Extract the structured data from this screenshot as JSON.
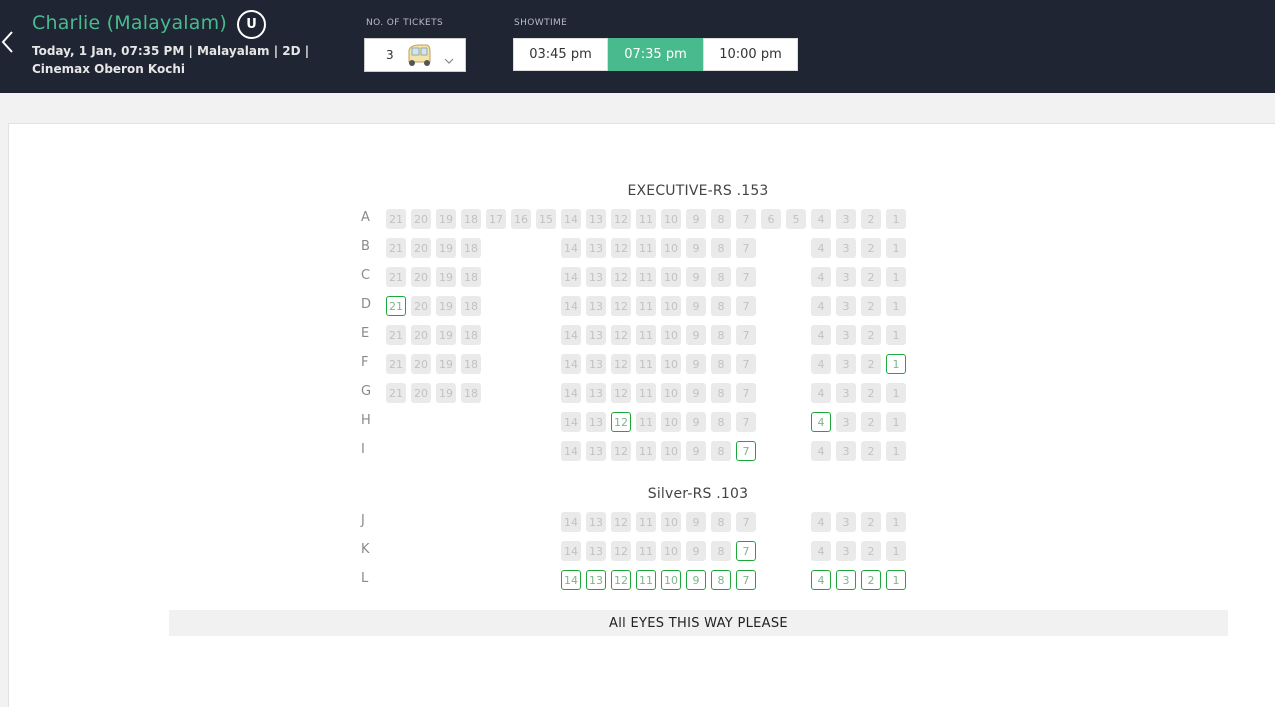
{
  "header": {
    "movie_title": "Charlie (Malayalam)",
    "certificate": "U",
    "show_line1": "Today, 1 Jan, 07:35 PM | Malayalam | 2D |",
    "show_line2": "Cinemax Oberon Kochi"
  },
  "tickets": {
    "label": "NO. OF TICKETS",
    "value": "3"
  },
  "showtime": {
    "label": "SHOWTIME",
    "options": [
      {
        "label": "03:45 pm",
        "selected": false
      },
      {
        "label": "07:35 pm",
        "selected": true
      },
      {
        "label": "10:00 pm",
        "selected": false
      }
    ]
  },
  "colors": {
    "brand_green": "#49ba8e",
    "available_border": "#1ea83c",
    "header_bg": "#1f2533",
    "sold_bg": "#eaeaea"
  },
  "sections": [
    {
      "title": "EXECUTIVE-RS .153"
    },
    {
      "title": "Silver-RS .103"
    }
  ],
  "seat_rows": [
    {
      "row": "A",
      "section": 0,
      "seats": [
        {
          "n": "21",
          "a": false
        },
        {
          "n": "20",
          "a": false
        },
        {
          "n": "19",
          "a": false
        },
        {
          "n": "18",
          "a": false
        },
        {
          "n": "17",
          "a": false
        },
        {
          "n": "16",
          "a": false
        },
        {
          "n": "15",
          "a": false
        },
        {
          "n": "14",
          "a": false
        },
        {
          "n": "13",
          "a": false
        },
        {
          "n": "12",
          "a": false
        },
        {
          "n": "11",
          "a": false
        },
        {
          "n": "10",
          "a": false
        },
        {
          "n": "9",
          "a": false
        },
        {
          "n": "8",
          "a": false
        },
        {
          "n": "7",
          "a": false
        },
        {
          "n": "6",
          "a": false
        },
        {
          "n": "5",
          "a": false
        },
        {
          "n": "4",
          "a": false
        },
        {
          "n": "3",
          "a": false
        },
        {
          "n": "2",
          "a": false
        },
        {
          "n": "1",
          "a": false
        }
      ]
    },
    {
      "row": "B",
      "section": 0,
      "seats": [
        {
          "n": "21",
          "a": false
        },
        {
          "n": "20",
          "a": false
        },
        {
          "n": "19",
          "a": false
        },
        {
          "n": "18",
          "a": false
        },
        null,
        null,
        null,
        {
          "n": "14",
          "a": false
        },
        {
          "n": "13",
          "a": false
        },
        {
          "n": "12",
          "a": false
        },
        {
          "n": "11",
          "a": false
        },
        {
          "n": "10",
          "a": false
        },
        {
          "n": "9",
          "a": false
        },
        {
          "n": "8",
          "a": false
        },
        {
          "n": "7",
          "a": false
        },
        null,
        null,
        {
          "n": "4",
          "a": false
        },
        {
          "n": "3",
          "a": false
        },
        {
          "n": "2",
          "a": false
        },
        {
          "n": "1",
          "a": false
        }
      ]
    },
    {
      "row": "C",
      "section": 0,
      "seats": [
        {
          "n": "21",
          "a": false
        },
        {
          "n": "20",
          "a": false
        },
        {
          "n": "19",
          "a": false
        },
        {
          "n": "18",
          "a": false
        },
        null,
        null,
        null,
        {
          "n": "14",
          "a": false
        },
        {
          "n": "13",
          "a": false
        },
        {
          "n": "12",
          "a": false
        },
        {
          "n": "11",
          "a": false
        },
        {
          "n": "10",
          "a": false
        },
        {
          "n": "9",
          "a": false
        },
        {
          "n": "8",
          "a": false
        },
        {
          "n": "7",
          "a": false
        },
        null,
        null,
        {
          "n": "4",
          "a": false
        },
        {
          "n": "3",
          "a": false
        },
        {
          "n": "2",
          "a": false
        },
        {
          "n": "1",
          "a": false
        }
      ]
    },
    {
      "row": "D",
      "section": 0,
      "seats": [
        {
          "n": "21",
          "a": true
        },
        {
          "n": "20",
          "a": false
        },
        {
          "n": "19",
          "a": false
        },
        {
          "n": "18",
          "a": false
        },
        null,
        null,
        null,
        {
          "n": "14",
          "a": false
        },
        {
          "n": "13",
          "a": false
        },
        {
          "n": "12",
          "a": false
        },
        {
          "n": "11",
          "a": false
        },
        {
          "n": "10",
          "a": false
        },
        {
          "n": "9",
          "a": false
        },
        {
          "n": "8",
          "a": false
        },
        {
          "n": "7",
          "a": false
        },
        null,
        null,
        {
          "n": "4",
          "a": false
        },
        {
          "n": "3",
          "a": false
        },
        {
          "n": "2",
          "a": false
        },
        {
          "n": "1",
          "a": false
        }
      ]
    },
    {
      "row": "E",
      "section": 0,
      "seats": [
        {
          "n": "21",
          "a": false
        },
        {
          "n": "20",
          "a": false
        },
        {
          "n": "19",
          "a": false
        },
        {
          "n": "18",
          "a": false
        },
        null,
        null,
        null,
        {
          "n": "14",
          "a": false
        },
        {
          "n": "13",
          "a": false
        },
        {
          "n": "12",
          "a": false
        },
        {
          "n": "11",
          "a": false
        },
        {
          "n": "10",
          "a": false
        },
        {
          "n": "9",
          "a": false
        },
        {
          "n": "8",
          "a": false
        },
        {
          "n": "7",
          "a": false
        },
        null,
        null,
        {
          "n": "4",
          "a": false
        },
        {
          "n": "3",
          "a": false
        },
        {
          "n": "2",
          "a": false
        },
        {
          "n": "1",
          "a": false
        }
      ]
    },
    {
      "row": "F",
      "section": 0,
      "seats": [
        {
          "n": "21",
          "a": false
        },
        {
          "n": "20",
          "a": false
        },
        {
          "n": "19",
          "a": false
        },
        {
          "n": "18",
          "a": false
        },
        null,
        null,
        null,
        {
          "n": "14",
          "a": false
        },
        {
          "n": "13",
          "a": false
        },
        {
          "n": "12",
          "a": false
        },
        {
          "n": "11",
          "a": false
        },
        {
          "n": "10",
          "a": false
        },
        {
          "n": "9",
          "a": false
        },
        {
          "n": "8",
          "a": false
        },
        {
          "n": "7",
          "a": false
        },
        null,
        null,
        {
          "n": "4",
          "a": false
        },
        {
          "n": "3",
          "a": false
        },
        {
          "n": "2",
          "a": false
        },
        {
          "n": "1",
          "a": true
        }
      ]
    },
    {
      "row": "G",
      "section": 0,
      "seats": [
        {
          "n": "21",
          "a": false
        },
        {
          "n": "20",
          "a": false
        },
        {
          "n": "19",
          "a": false
        },
        {
          "n": "18",
          "a": false
        },
        null,
        null,
        null,
        {
          "n": "14",
          "a": false
        },
        {
          "n": "13",
          "a": false
        },
        {
          "n": "12",
          "a": false
        },
        {
          "n": "11",
          "a": false
        },
        {
          "n": "10",
          "a": false
        },
        {
          "n": "9",
          "a": false
        },
        {
          "n": "8",
          "a": false
        },
        {
          "n": "7",
          "a": false
        },
        null,
        null,
        {
          "n": "4",
          "a": false
        },
        {
          "n": "3",
          "a": false
        },
        {
          "n": "2",
          "a": false
        },
        {
          "n": "1",
          "a": false
        }
      ]
    },
    {
      "row": "H",
      "section": 0,
      "seats": [
        null,
        null,
        null,
        null,
        null,
        null,
        null,
        {
          "n": "14",
          "a": false
        },
        {
          "n": "13",
          "a": false
        },
        {
          "n": "12",
          "a": true
        },
        {
          "n": "11",
          "a": false
        },
        {
          "n": "10",
          "a": false
        },
        {
          "n": "9",
          "a": false
        },
        {
          "n": "8",
          "a": false
        },
        {
          "n": "7",
          "a": false
        },
        null,
        null,
        {
          "n": "4",
          "a": true
        },
        {
          "n": "3",
          "a": false
        },
        {
          "n": "2",
          "a": false
        },
        {
          "n": "1",
          "a": false
        }
      ]
    },
    {
      "row": "I",
      "section": 0,
      "seats": [
        null,
        null,
        null,
        null,
        null,
        null,
        null,
        {
          "n": "14",
          "a": false
        },
        {
          "n": "13",
          "a": false
        },
        {
          "n": "12",
          "a": false
        },
        {
          "n": "11",
          "a": false
        },
        {
          "n": "10",
          "a": false
        },
        {
          "n": "9",
          "a": false
        },
        {
          "n": "8",
          "a": false
        },
        {
          "n": "7",
          "a": true
        },
        null,
        null,
        {
          "n": "4",
          "a": false
        },
        {
          "n": "3",
          "a": false
        },
        {
          "n": "2",
          "a": false
        },
        {
          "n": "1",
          "a": false
        }
      ]
    },
    {
      "row": "J",
      "section": 1,
      "seats": [
        null,
        null,
        null,
        null,
        null,
        null,
        null,
        {
          "n": "14",
          "a": false
        },
        {
          "n": "13",
          "a": false
        },
        {
          "n": "12",
          "a": false
        },
        {
          "n": "11",
          "a": false
        },
        {
          "n": "10",
          "a": false
        },
        {
          "n": "9",
          "a": false
        },
        {
          "n": "8",
          "a": false
        },
        {
          "n": "7",
          "a": false
        },
        null,
        null,
        {
          "n": "4",
          "a": false
        },
        {
          "n": "3",
          "a": false
        },
        {
          "n": "2",
          "a": false
        },
        {
          "n": "1",
          "a": false
        }
      ]
    },
    {
      "row": "K",
      "section": 1,
      "seats": [
        null,
        null,
        null,
        null,
        null,
        null,
        null,
        {
          "n": "14",
          "a": false
        },
        {
          "n": "13",
          "a": false
        },
        {
          "n": "12",
          "a": false
        },
        {
          "n": "11",
          "a": false
        },
        {
          "n": "10",
          "a": false
        },
        {
          "n": "9",
          "a": false
        },
        {
          "n": "8",
          "a": false
        },
        {
          "n": "7",
          "a": true
        },
        null,
        null,
        {
          "n": "4",
          "a": false
        },
        {
          "n": "3",
          "a": false
        },
        {
          "n": "2",
          "a": false
        },
        {
          "n": "1",
          "a": false
        }
      ]
    },
    {
      "row": "L",
      "section": 1,
      "seats": [
        null,
        null,
        null,
        null,
        null,
        null,
        null,
        {
          "n": "14",
          "a": true
        },
        {
          "n": "13",
          "a": true
        },
        {
          "n": "12",
          "a": true
        },
        {
          "n": "11",
          "a": true
        },
        {
          "n": "10",
          "a": true
        },
        {
          "n": "9",
          "a": true
        },
        {
          "n": "8",
          "a": true
        },
        {
          "n": "7",
          "a": true
        },
        null,
        null,
        {
          "n": "4",
          "a": true
        },
        {
          "n": "3",
          "a": true
        },
        {
          "n": "2",
          "a": true
        },
        {
          "n": "1",
          "a": true
        }
      ]
    }
  ],
  "screen_label": "All EYES THIS WAY PLEASE"
}
